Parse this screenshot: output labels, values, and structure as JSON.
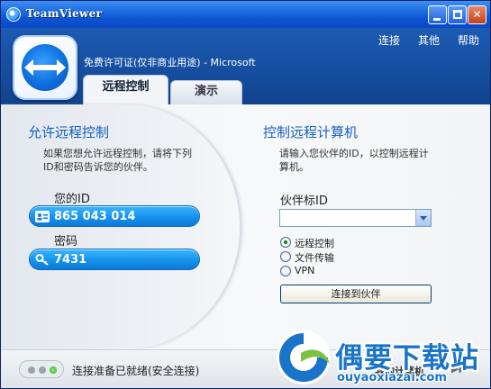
{
  "window": {
    "title": "TeamViewer",
    "colors": {
      "titlebar": "#0d55d4",
      "header": "#154d9e",
      "accent": "#1560c2",
      "pill": "#1896ee"
    }
  },
  "menu": [
    "连接",
    "其他",
    "帮助"
  ],
  "header": {
    "license": "免费许可证(仅非商业用途) - Microsoft"
  },
  "tabs": [
    {
      "label": "远程控制",
      "active": true
    },
    {
      "label": "演示",
      "active": false
    }
  ],
  "allow": {
    "heading": "允许远程控制",
    "description": [
      "如果您想允许远程控制，请将下列",
      "ID和密码告诉您的伙伴。"
    ],
    "id_label": "您的ID",
    "id_value": "865 043 014",
    "password_label": "密码",
    "password_value": "7431"
  },
  "control": {
    "heading": "控制远程计算机",
    "description": [
      "请输入您伙伴的ID，以控制远程计",
      "算机。"
    ],
    "partner_label": "伙伴标ID",
    "partner_value": "",
    "modes": [
      {
        "label": "远程控制",
        "selected": true
      },
      {
        "label": "文件传输",
        "selected": false
      },
      {
        "label": "VPN",
        "selected": false
      }
    ],
    "connect_label": "连接到伙伴"
  },
  "status": {
    "text": "连接准备已就绪(安全连接)",
    "my_computer": "我的计算机"
  },
  "watermark": {
    "name": "偶要下载站",
    "url": "ouyaoxiazai.com"
  }
}
